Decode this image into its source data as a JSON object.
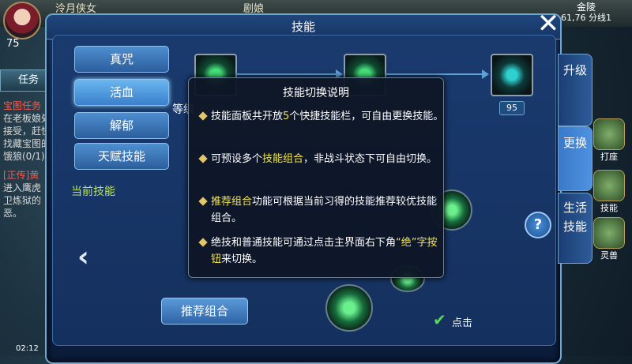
{
  "hud": {
    "player_name": "泠月侠女",
    "player_level": "75",
    "target_name": "剧娘",
    "map_name": "金陵",
    "coords": "61,76 分线1",
    "quest_tab": "任务",
    "quest_lines": [
      "宝图任务",
      "在老板娘处",
      "接受，赶快",
      "找藏宝图的",
      "饿狼(0/1)",
      "[正传]黄",
      "进入鹰虎",
      "卫炼狱的",
      "恶。"
    ],
    "time": "02:12",
    "right_items": [
      "打座",
      "技能",
      "灵兽"
    ]
  },
  "panel": {
    "title": "技能",
    "categories": [
      "真咒",
      "活血",
      "解郁",
      "天赋技能"
    ],
    "current_skills_label": "当前技能",
    "grade_label": "等级",
    "level_badge": "95",
    "recommend_label": "推荐组合",
    "click_label": "点击",
    "side_tabs": [
      "升级",
      "更换",
      "生活技能"
    ]
  },
  "tooltip": {
    "title": "技能切换说明",
    "items": [
      {
        "parts": [
          "技能面板共开放",
          "5",
          "个快捷技能栏，可自由更换技能。"
        ]
      },
      {
        "parts": [
          "可预设多个",
          "技能组合",
          "，非战斗状态下可自由切换。"
        ]
      },
      {
        "parts": [
          "",
          "推荐组合",
          "功能可根据当前习得的技能推荐较优技能组合。"
        ]
      },
      {
        "parts": [
          "绝技和普通技能可通过点击主界面右下角",
          "“绝”字按钮",
          "来切换。"
        ]
      }
    ]
  },
  "colors": {
    "accent": "#5fa3d6",
    "highlight": "#f2e44a",
    "current_label": "#b8e06a"
  }
}
